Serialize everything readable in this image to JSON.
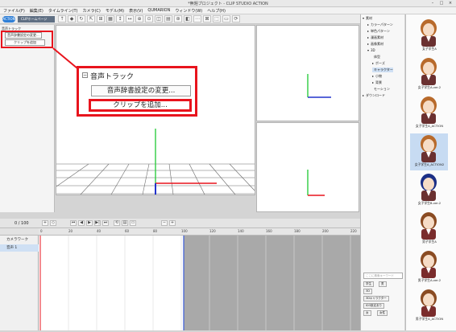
{
  "window": {
    "title": "*無題プロジェクト - CLIP STUDIO ACTION",
    "controls": [
      "–",
      "□",
      "×"
    ]
  },
  "menu": [
    "ファイル(F)",
    "編集(E)",
    "タイムライン(T)",
    "カメラ(C)",
    "モデル(M)",
    "表示(V)",
    "QUMARION",
    "ウィンドウ(W)",
    "ヘルプ(H)"
  ],
  "toolbar": {
    "logo_label": "ACTION",
    "home_label": "CLIPホームページ",
    "icons": [
      "↑",
      "◆",
      "↻",
      "⇱",
      "⊞",
      "▦",
      "↕",
      "↔",
      "⊕",
      "⊙",
      "◫",
      "▤",
      "⊛",
      "◧",
      "⋯",
      "⊠",
      "⬚",
      "▭",
      "⟳"
    ]
  },
  "left_panel": {
    "track": "音声トラック",
    "items": [
      "音声辞書設定の変更...",
      "クリップを追加"
    ]
  },
  "callout": {
    "minus": "−",
    "header": "音声トラック",
    "item1": "音声辞書設定の変更...",
    "item2": "クリップを追加..."
  },
  "timeline": {
    "frame_counter": "0 / 100",
    "controls": [
      "+",
      "◇",
      "⏮",
      "◀",
      "▶",
      "▶|",
      "⏭",
      "⟲",
      "▤",
      "▭",
      "−",
      "+"
    ],
    "ruler_ticks": [
      "0",
      "20",
      "40",
      "60",
      "80",
      "100",
      "120",
      "140",
      "160",
      "180",
      "200",
      "220"
    ],
    "tracks": [
      {
        "label": "カメラワーク"
      },
      {
        "label": "音声 1"
      }
    ]
  },
  "material_tree": [
    {
      "label": "素材",
      "prefix": "▾"
    },
    {
      "label": "カラーパターン",
      "prefix": "▸"
    },
    {
      "label": "単色パターン",
      "prefix": "▸"
    },
    {
      "label": "漫画素材",
      "prefix": "▸"
    },
    {
      "label": "画像素材",
      "prefix": "▸"
    },
    {
      "label": "3D",
      "prefix": "▾"
    },
    {
      "label": "体型",
      "prefix": ""
    },
    {
      "label": "ポーズ",
      "prefix": "▸"
    },
    {
      "label": "キャラクター",
      "prefix": ""
    },
    {
      "label": "小物",
      "prefix": "▸"
    },
    {
      "label": "背景",
      "prefix": "▸"
    },
    {
      "label": "モーション",
      "prefix": ""
    },
    {
      "label": "ダウンロード",
      "prefix": "▸"
    }
  ],
  "search": {
    "placeholder": "ここに検索キーワード"
  },
  "tags": [
    "学生",
    "男",
    "3D",
    "3Dキャラクター",
    "ID3設定あり",
    "女",
    "女性"
  ],
  "thumbnails": [
    {
      "caption": "女子学生A"
    },
    {
      "caption": "女子学生A-ver.2"
    },
    {
      "caption": "女子学生A_ACTION"
    },
    {
      "caption": "女子学生A_ACTION2"
    },
    {
      "caption": "女子学生B-ver.2"
    },
    {
      "caption": "男子学生A"
    },
    {
      "caption": "男子学生A-ver.2"
    },
    {
      "caption": "男子学生A_ACTION"
    }
  ],
  "colors": {
    "accent": "#e8141d",
    "axis_x": "#e8141d",
    "axis_y": "#2ecc40",
    "axis_z": "#2233cc",
    "selection": "#cfe0f4"
  }
}
